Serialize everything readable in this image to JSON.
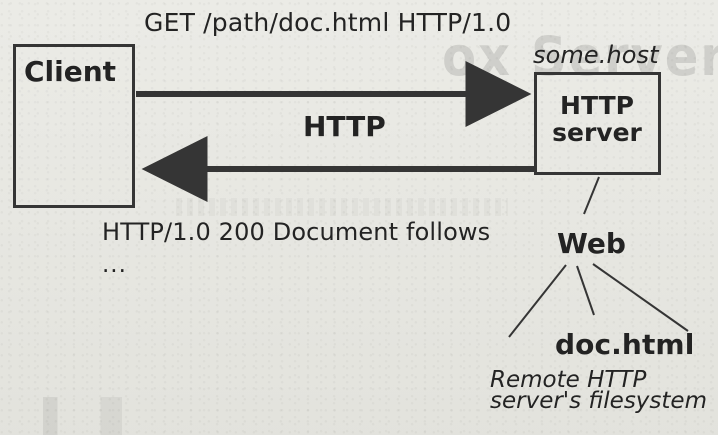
{
  "diagram": {
    "request": "GET /path/doc.html HTTP/1.0",
    "host": "some.host",
    "client": "Client",
    "server": "HTTP\nserver",
    "protocol": "HTTP",
    "response": "HTTP/1.0 200 Document follows",
    "ellipsis": "...",
    "web": "Web",
    "file": "doc.html",
    "caption": "Remote HTTP\nserver's filesystem"
  },
  "background_text": {
    "ghost_title": "ox Server 代理伺服器"
  },
  "colors": {
    "line": "#353535",
    "text": "#232323",
    "paper": "#e7e7e1"
  }
}
